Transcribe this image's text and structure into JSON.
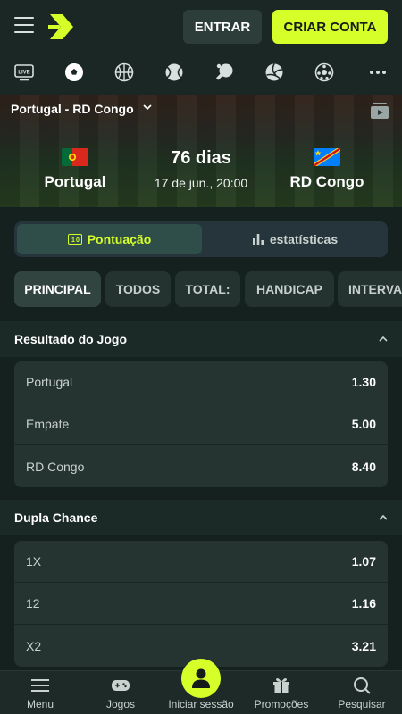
{
  "header": {
    "login_label": "ENTRAR",
    "signup_label": "CRIAR CONTA"
  },
  "sports_tabs": [
    {
      "icon": "live-tv-icon",
      "label": "LIVE"
    },
    {
      "icon": "soccer-ball-icon",
      "active": true
    },
    {
      "icon": "basketball-icon"
    },
    {
      "icon": "tennis-ball-icon"
    },
    {
      "icon": "table-tennis-icon"
    },
    {
      "icon": "volleyball-icon"
    },
    {
      "icon": "futsal-ball-icon"
    },
    {
      "icon": "more-dots-icon"
    }
  ],
  "match": {
    "title": "Portugal - RD Congo",
    "home_team": "Portugal",
    "away_team": "RD Congo",
    "countdown": "76 dias",
    "date": "17 de jun., 20:00"
  },
  "toggle": {
    "score_label": "Pontuação",
    "stats_label": "estatísticas"
  },
  "market_tabs": [
    "PRINCIPAL",
    "TODOS",
    "TOTAL:",
    "HANDICAP",
    "INTERVALO"
  ],
  "sections": [
    {
      "title": "Resultado do Jogo",
      "odds": [
        {
          "label": "Portugal",
          "value": "1.30"
        },
        {
          "label": "Empate",
          "value": "5.00"
        },
        {
          "label": "RD Congo",
          "value": "8.40"
        }
      ]
    },
    {
      "title": "Dupla Chance",
      "odds": [
        {
          "label": "1X",
          "value": "1.07"
        },
        {
          "label": "12",
          "value": "1.16"
        },
        {
          "label": "X2",
          "value": "3.21"
        }
      ]
    }
  ],
  "bottom_nav": [
    "Menu",
    "Jogos",
    "Iniciar sessão",
    "Promoções",
    "Pesquisar"
  ],
  "colors": {
    "accent": "#d6ff2a",
    "background": "#15211f"
  }
}
